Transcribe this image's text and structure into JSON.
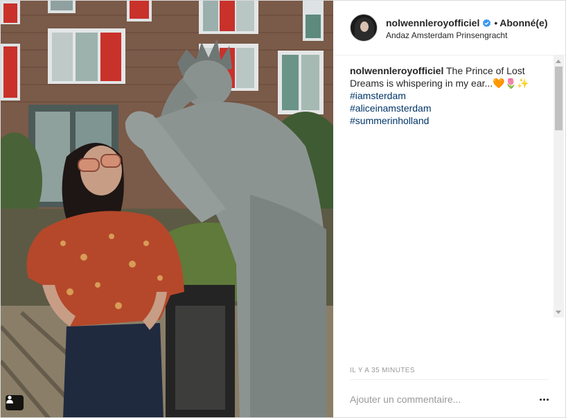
{
  "post": {
    "username": "nolwennleroyofficiel",
    "separator": "•",
    "follow_label": "Abonné(e)",
    "location": "Andaz Amsterdam Prinsengracht",
    "caption": {
      "username": "nolwennleroyofficiel",
      "text": "The Prince of Lost Dreams is whispering in my ear...",
      "emojis": "🧡🌷✨",
      "hashtags": [
        "#iamsterdam",
        "#aliceinamsterdam",
        "#summerinholland"
      ]
    },
    "timestamp": "IL Y A 35 MINUTES",
    "comment_placeholder": "Ajouter un commentaire..."
  },
  "icons": {
    "verified": "verified-badge-icon",
    "tag": "user-tag-icon",
    "more": "more-options-icon"
  },
  "colors": {
    "hashtag": "#003569",
    "verified": "#3897f0",
    "text": "#262626",
    "muted": "#999999"
  }
}
